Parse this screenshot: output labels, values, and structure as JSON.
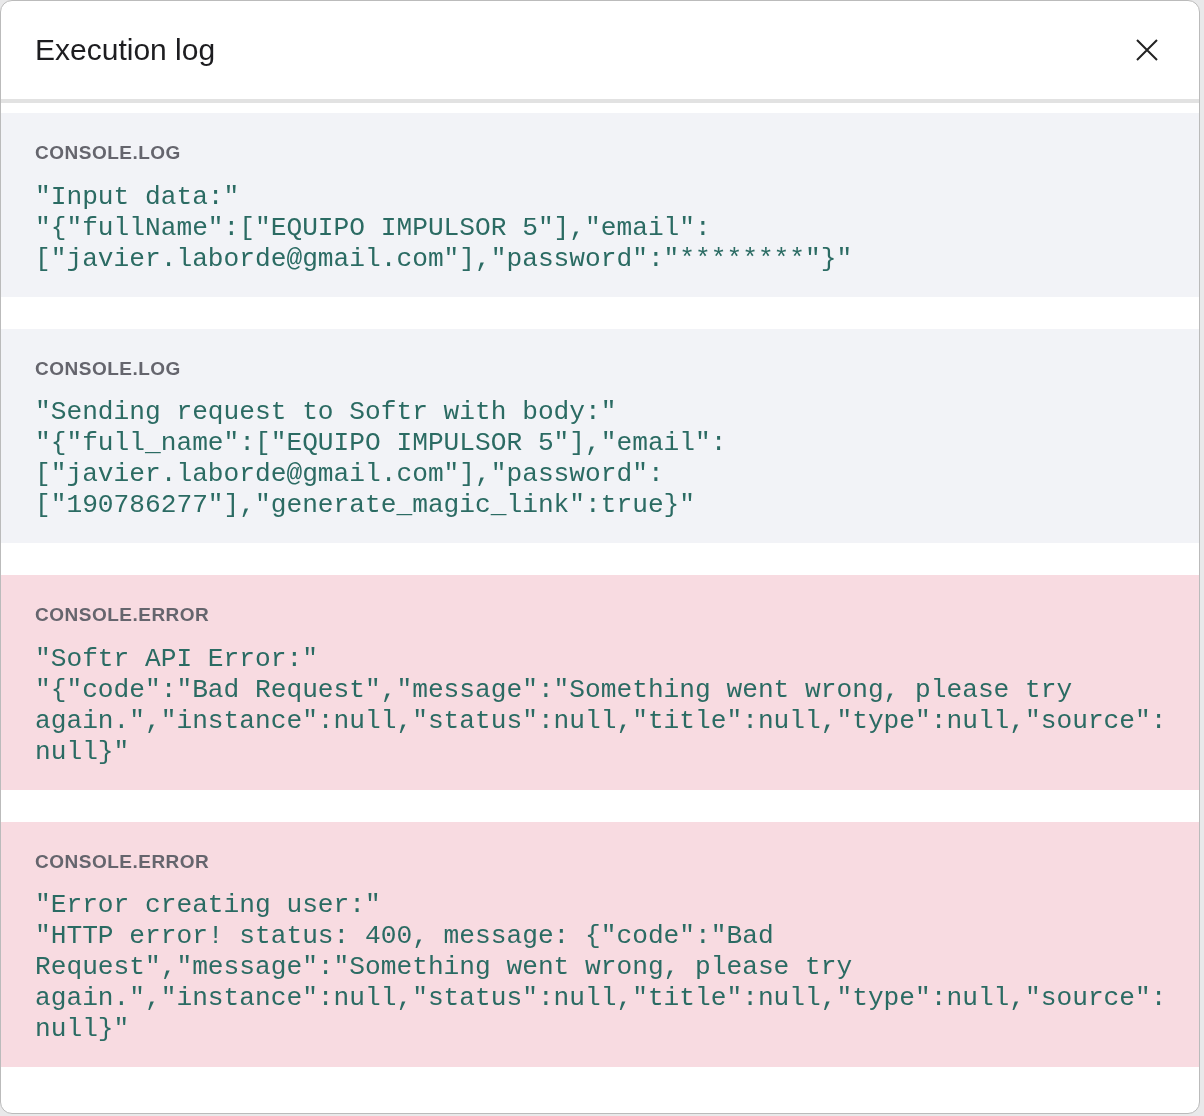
{
  "window": {
    "title": "Execution log"
  },
  "entries": [
    {
      "kind": "log",
      "label": "CONSOLE.LOG",
      "lines": [
        "\"Input data:\"",
        "\"{\"fullName\":[\"EQUIPO IMPULSOR 5\"],\"email\":",
        "[\"javier.laborde@gmail.com\"],\"password\":\"********\"}\""
      ]
    },
    {
      "kind": "log",
      "label": "CONSOLE.LOG",
      "lines": [
        "\"Sending request to Softr with body:\"",
        "\"{\"full_name\":[\"EQUIPO IMPULSOR 5\"],\"email\":",
        "[\"javier.laborde@gmail.com\"],\"password\":",
        "[\"190786277\"],\"generate_magic_link\":true}\""
      ]
    },
    {
      "kind": "error",
      "label": "CONSOLE.ERROR",
      "lines": [
        "\"Softr API Error:\"",
        "\"{\"code\":\"Bad Request\",\"message\":\"Something went wrong, please try",
        "again.\",\"instance\":null,\"status\":null,\"title\":null,\"type\":null,\"source\":",
        "null}\""
      ]
    },
    {
      "kind": "error",
      "label": "CONSOLE.ERROR",
      "lines": [
        "\"Error creating user:\"",
        "\"HTTP error! status: 400, message: {\"code\":\"Bad",
        "Request\",\"message\":\"Something went wrong, please try",
        "again.\",\"instance\":null,\"status\":null,\"title\":null,\"type\":null,\"source\":",
        "null}\""
      ]
    }
  ]
}
